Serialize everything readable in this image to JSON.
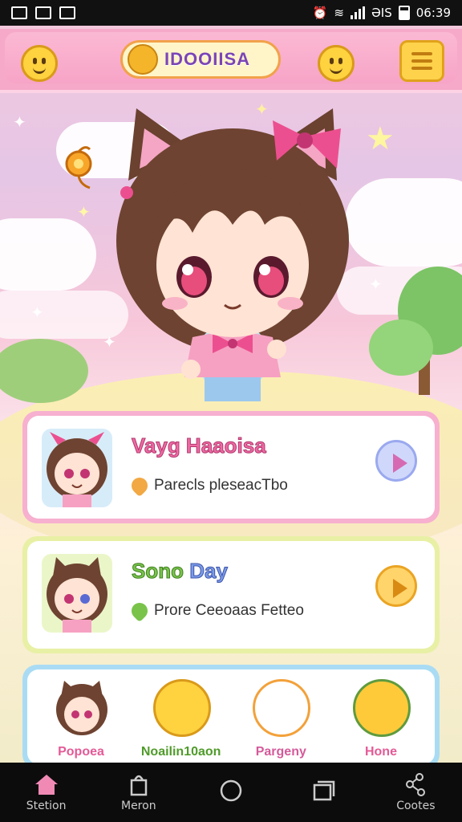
{
  "status_bar": {
    "time": "06:39",
    "network": "ƏIS"
  },
  "header": {
    "logo_text": "IDOOIISA"
  },
  "cards": [
    {
      "title": "Vayg Haaoisa",
      "subtitle": "Parecls pleseacTbo"
    },
    {
      "title_part1": "Sono",
      "title_part2": "Day",
      "subtitle": "Prore Ceeoaas Fetteo"
    }
  ],
  "roster": [
    {
      "label": "Popoea"
    },
    {
      "label": "Noailin10aon"
    },
    {
      "label": "Pargeny"
    },
    {
      "label": "Hone"
    }
  ],
  "nav": [
    {
      "label": "Stetion",
      "icon": "home-icon"
    },
    {
      "label": "Meron",
      "icon": "bag-icon"
    },
    {
      "label": "",
      "icon": "circle-home-icon"
    },
    {
      "label": "",
      "icon": "recents-icon"
    },
    {
      "label": "Cootes",
      "icon": "share-icon"
    }
  ],
  "colors": {
    "header_pink": "#f6a9c9",
    "card1_border": "#f7b0cf",
    "card2_border": "#e8f0a5",
    "card3_border": "#a9dcf4"
  }
}
